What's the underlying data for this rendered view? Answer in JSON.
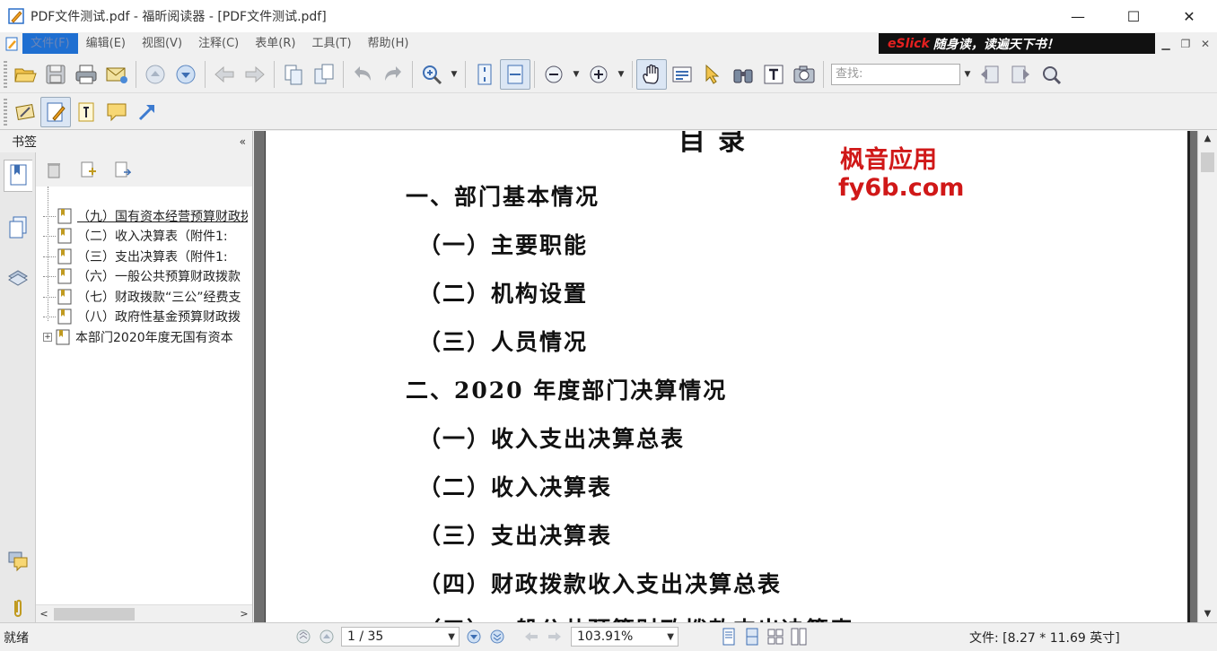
{
  "window": {
    "title": "PDF文件测试.pdf - 福昕阅读器 - [PDF文件测试.pdf]",
    "controls": {
      "minimize": "—",
      "maximize": "☐",
      "close": "✕"
    }
  },
  "menu": {
    "items": [
      "文件(F)",
      "编辑(E)",
      "视图(V)",
      "注释(C)",
      "表单(R)",
      "工具(T)",
      "帮助(H)"
    ],
    "active_index": 0,
    "promo_brand": "eSlick",
    "promo_text": "随身读，读遍天下书！"
  },
  "toolbar": {
    "search_placeholder": "查找:",
    "accent": "#1f6fd1"
  },
  "sidebar": {
    "title": "书签",
    "collapse_icon": "«",
    "bookmarks": [
      {
        "label": "（九）国有资本经营预算财政拨款",
        "selected": true,
        "indent": 1
      },
      {
        "label": "（二）收入决算表（附件1:",
        "selected": false,
        "indent": 1
      },
      {
        "label": "（三）支出决算表（附件1:",
        "selected": false,
        "indent": 1
      },
      {
        "label": "（六）一般公共预算财政拨款",
        "selected": false,
        "indent": 1
      },
      {
        "label": "（七）财政拨款“三公”经费支",
        "selected": false,
        "indent": 1
      },
      {
        "label": "（八）政府性基金预算财政拨",
        "selected": false,
        "indent": 1
      },
      {
        "label": "本部门2020年度无国有资本",
        "selected": false,
        "indent": 0,
        "expandable": true
      }
    ]
  },
  "document": {
    "title": "目录",
    "lines": [
      {
        "text": "一、部门基本情况",
        "level": 0
      },
      {
        "text": "（一）主要职能",
        "level": 1
      },
      {
        "text": "（二）机构设置",
        "level": 1
      },
      {
        "text": "（三）人员情况",
        "level": 1
      },
      {
        "text": "二、2020 年度部门决算情况",
        "level": 0
      },
      {
        "text": "（一）收入支出决算总表",
        "level": 1
      },
      {
        "text": "（二）收入决算表",
        "level": 1
      },
      {
        "text": "（三）支出决算表",
        "level": 1
      },
      {
        "text": "（四）财政拨款收入支出决算总表",
        "level": 1
      },
      {
        "text": "（五）一般公共预算财政拨款支出决算表",
        "level": 1
      }
    ],
    "watermark_line1": "枫音应用",
    "watermark_line2": "fy6b.com"
  },
  "status": {
    "text": "就绪",
    "page_indicator": "1 / 35",
    "zoom": "103.91%",
    "file_size": "文件: [8.27 * 11.69 英寸]"
  }
}
